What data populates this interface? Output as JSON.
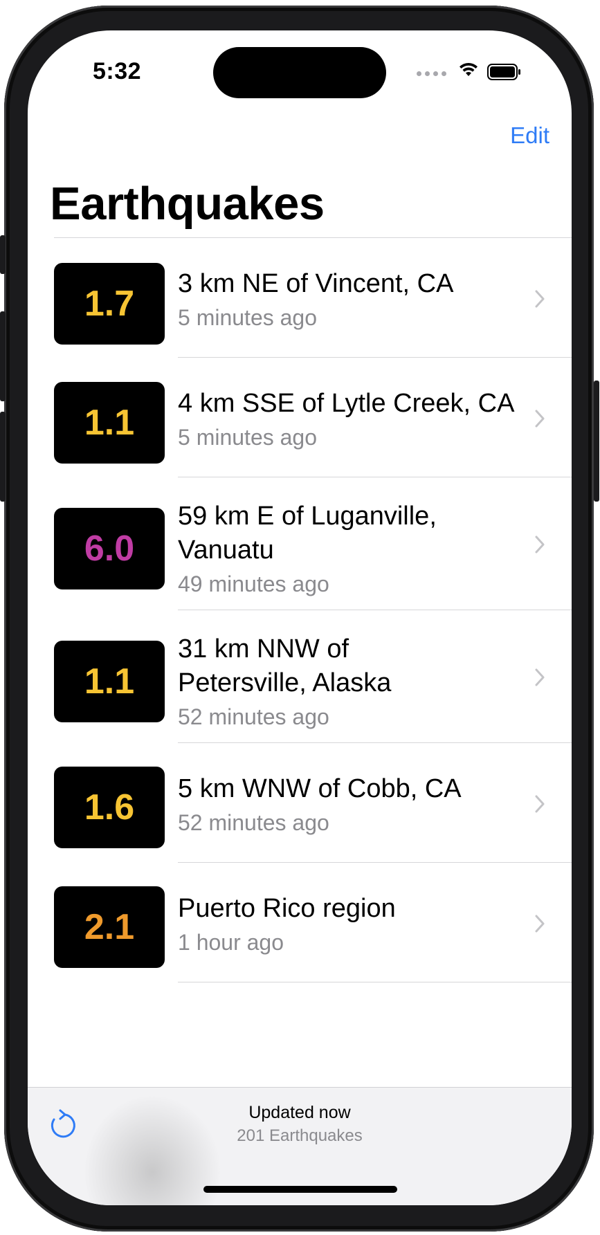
{
  "status_bar": {
    "time": "5:32"
  },
  "nav": {
    "edit_label": "Edit",
    "title": "Earthquakes"
  },
  "quakes": [
    {
      "magnitude": "1.7",
      "color": "#f7c433",
      "place": "3 km NE of Vincent, CA",
      "time": "5 minutes ago"
    },
    {
      "magnitude": "1.1",
      "color": "#f7c433",
      "place": "4 km SSE of Lytle Creek, CA",
      "time": "5 minutes ago"
    },
    {
      "magnitude": "6.0",
      "color": "#c03ca4",
      "place_line1": "59 km E of Luganville,",
      "place_line2": "Vanuatu",
      "time": "49 minutes ago"
    },
    {
      "magnitude": "1.1",
      "color": "#f7c433",
      "place_line1": "31 km NNW of",
      "place_line2": "Petersville, Alaska",
      "time": "52 minutes ago"
    },
    {
      "magnitude": "1.6",
      "color": "#f7c433",
      "place": "5 km WNW of Cobb, CA",
      "time": "52 minutes ago"
    },
    {
      "magnitude": "2.1",
      "color": "#ef9a2c",
      "place": "Puerto Rico region",
      "time": "1 hour ago"
    }
  ],
  "toolbar": {
    "status": "Updated now",
    "count": "201 Earthquakes",
    "refresh_icon": "arrow-clockwise-icon"
  },
  "colors": {
    "accent": "#2f7cf6",
    "secondary_text": "#8a8a8e"
  }
}
